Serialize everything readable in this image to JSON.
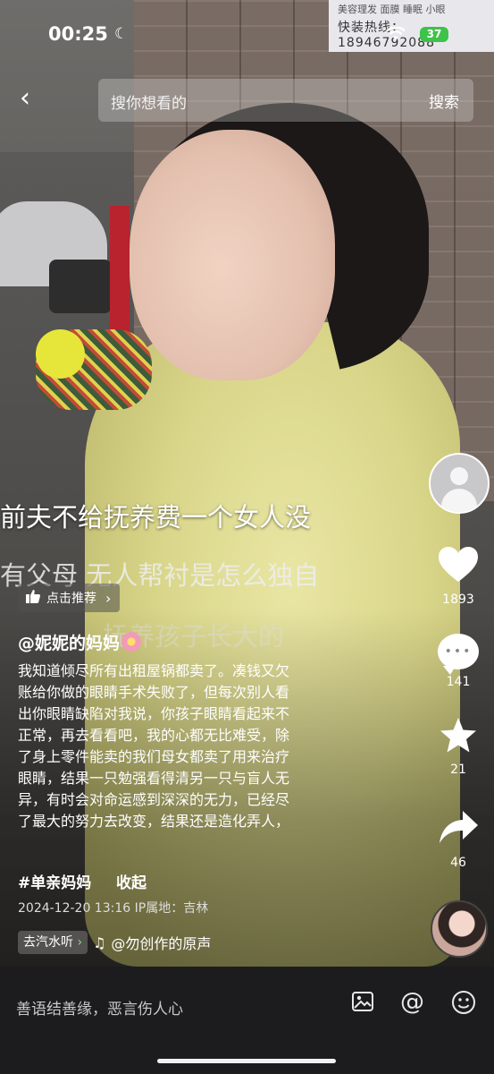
{
  "status": {
    "time": "00:25",
    "battery": "37"
  },
  "search": {
    "placeholder": "搜你想看的",
    "button": "搜索"
  },
  "video_sign": {
    "line1": "美容理发 面膜 睡眠 小眼",
    "line2": "快装热线：18946792088"
  },
  "overlay": {
    "line1": "前夫不给抚养费一个女人没",
    "line2": "有父母 无人帮衬是怎么独自",
    "line3": "抚养孩子长大的"
  },
  "recommend": {
    "label": "点击推荐"
  },
  "post": {
    "author": "@妮妮的妈妈",
    "description_lines": [
      "我知道倾尽所有出租屋锅都卖了。凑钱又欠",
      "账给你做的眼睛手术失败了，但每次别人看",
      "出你眼睛缺陷对我说，你孩子眼睛看起来不",
      "正常，再去看看吧，我的心都无比难受，除",
      "了身上零件能卖的我们母女都卖了用来治疗",
      "眼睛，结果一只勉强看得清另一只与盲人无",
      "异，有时会对命运感到深深的无力，已经尽",
      "了最大的努力去改变，结果还是造化弄人，"
    ],
    "hashtag": "#单亲妈妈",
    "collapse": "收起",
    "date": "2024-12-20 13:16",
    "ip": "IP属地：吉林"
  },
  "music": {
    "tag": "去汽水听",
    "name": "@勿创作的原声"
  },
  "actions": {
    "likes": "1893",
    "comments": "141",
    "favorites": "21",
    "shares": "46"
  },
  "bottom": {
    "comment_hint": "善语结善缘，恶言伤人心"
  }
}
